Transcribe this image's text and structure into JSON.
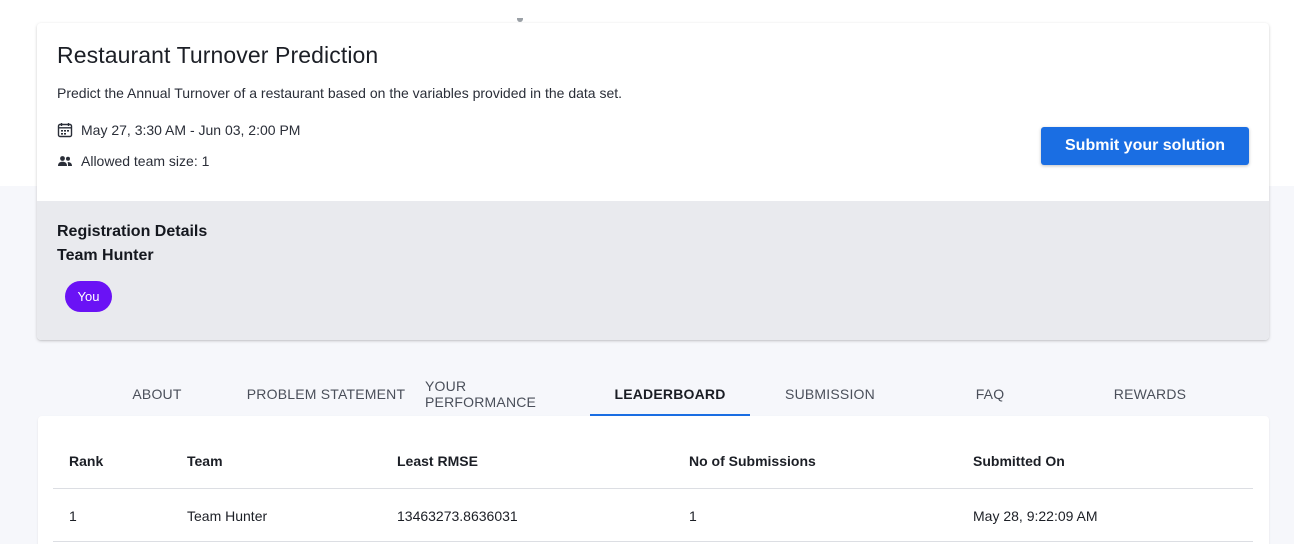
{
  "challenge": {
    "title": "Restaurant Turnover Prediction",
    "description": "Predict the Annual Turnover of a restaurant based on the variables provided in the data set.",
    "date_range": "May 27, 3:30 AM - Jun 03, 2:00 PM",
    "team_size": "Allowed team size: 1",
    "submit_label": "Submit your solution",
    "icons": {
      "date": "calendar-icon",
      "team": "people-icon"
    }
  },
  "registration": {
    "title": "Registration Details",
    "team_name": "Team Hunter",
    "member_badge": "You"
  },
  "tabs": [
    {
      "label": "ABOUT"
    },
    {
      "label": "PROBLEM STATEMENT"
    },
    {
      "label": "YOUR PERFORMANCE"
    },
    {
      "label": "LEADERBOARD",
      "active": true
    },
    {
      "label": "SUBMISSION"
    },
    {
      "label": "FAQ"
    },
    {
      "label": "REWARDS"
    }
  ],
  "leaderboard": {
    "columns": [
      "Rank",
      "Team",
      "Least RMSE",
      "No of Submissions",
      "Submitted On"
    ],
    "rows": [
      [
        "1",
        "Team Hunter",
        "13463273.8636031",
        "1",
        "May 28, 9:22:09 AM"
      ]
    ]
  },
  "colors": {
    "accent": "#1a6ee3",
    "badge": "#6a12f5",
    "registration_bg": "#e9eaee"
  }
}
